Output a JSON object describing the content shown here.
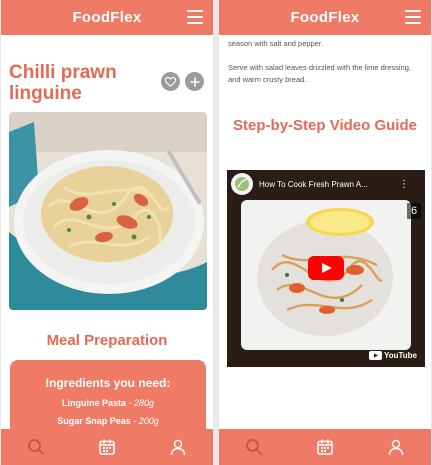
{
  "app": {
    "title": "FoodFlex"
  },
  "recipe": {
    "title": "Chilli prawn linguine",
    "meal_prep_heading": "Meal Preparation",
    "ingredients": {
      "heading": "Ingredients you need:",
      "items": [
        {
          "name": "Linguine Pasta",
          "separator": "-",
          "qty": "280g"
        },
        {
          "name": "Sugar Snap Peas",
          "separator": "-",
          "qty": "200g"
        }
      ]
    }
  },
  "method": {
    "line1": "season with salt and pepper.",
    "line2": "Serve with salad leaves drizzled with the lime dressing, and warm crusty bread."
  },
  "video": {
    "heading": "Step-by-Step Video Guide",
    "title": "How To Cook Fresh Prawn A...",
    "counter": "6",
    "brand": "YouTube"
  },
  "nav": {
    "items": [
      "search-icon",
      "calendar-icon",
      "user-icon"
    ]
  },
  "colors": {
    "brand": "#ef7a66",
    "heading": "#e36a55",
    "icon_button": "#9b9b9b",
    "play_button": "#ff0000"
  }
}
